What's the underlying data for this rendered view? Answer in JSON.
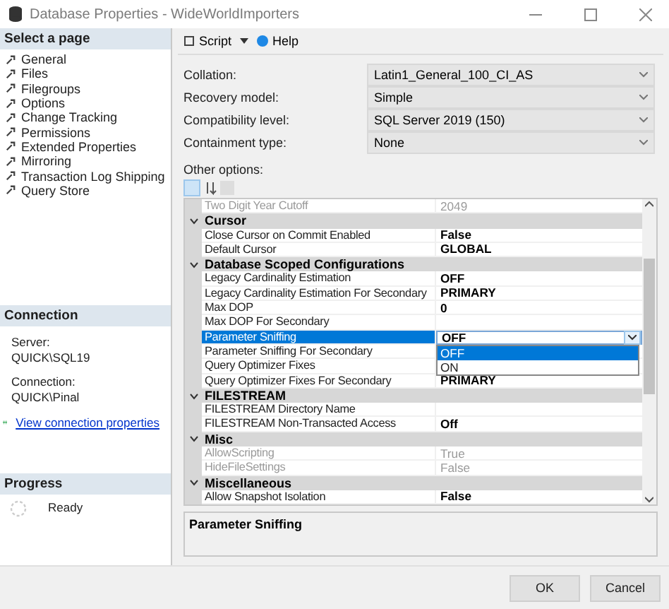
{
  "window": {
    "title": "Database Properties - WideWorldImporters"
  },
  "sidebar": {
    "header": "Select a page",
    "items": [
      {
        "label": "General"
      },
      {
        "label": "Files"
      },
      {
        "label": "Filegroups"
      },
      {
        "label": "Options"
      },
      {
        "label": "Change Tracking"
      },
      {
        "label": "Permissions"
      },
      {
        "label": "Extended Properties"
      },
      {
        "label": "Mirroring"
      },
      {
        "label": "Transaction Log Shipping"
      },
      {
        "label": "Query Store"
      }
    ]
  },
  "connection": {
    "header": "Connection",
    "server_label": "Server:",
    "server": "QUICK\\SQL19",
    "connection_label": "Connection:",
    "connection": "QUICK\\Pinal",
    "link": "View connection properties"
  },
  "progress": {
    "header": "Progress",
    "status": "Ready"
  },
  "toolbar": {
    "script": "Script",
    "help": "Help"
  },
  "fields": [
    {
      "label": "Collation:",
      "value": "Latin1_General_100_CI_AS"
    },
    {
      "label": "Recovery model:",
      "value": "Simple"
    },
    {
      "label": "Compatibility level:",
      "value": "SQL Server 2019 (150)"
    },
    {
      "label": "Containment type:",
      "value": "None"
    }
  ],
  "other_options_label": "Other options:",
  "grid": {
    "rows": [
      {
        "kind": "property",
        "name": "Two Digit Year Cutoff",
        "value": "2049",
        "disabled": true,
        "selected": false
      },
      {
        "kind": "category",
        "name": "Cursor",
        "expanded": true
      },
      {
        "kind": "property",
        "name": "Close Cursor on Commit Enabled",
        "value": "False",
        "disabled": false,
        "selected": false
      },
      {
        "kind": "property",
        "name": "Default Cursor",
        "value": "GLOBAL",
        "disabled": false,
        "selected": false
      },
      {
        "kind": "category",
        "name": "Database Scoped Configurations",
        "expanded": true
      },
      {
        "kind": "property",
        "name": "Legacy Cardinality Estimation",
        "value": "OFF",
        "disabled": false,
        "selected": false
      },
      {
        "kind": "property",
        "name": "Legacy Cardinality Estimation For Secondary",
        "value": "PRIMARY",
        "disabled": false,
        "selected": false
      },
      {
        "kind": "property",
        "name": "Max DOP",
        "value": "0",
        "disabled": false,
        "selected": false
      },
      {
        "kind": "property",
        "name": "Max DOP For Secondary",
        "disabled": false,
        "selected": false
      },
      {
        "kind": "property",
        "name": "Parameter Sniffing",
        "value": "OFF",
        "disabled": false,
        "selected": true,
        "dropdown": [
          {
            "label": "OFF",
            "selected": true
          },
          {
            "label": "ON",
            "selected": false
          }
        ]
      },
      {
        "kind": "property",
        "name": "Parameter Sniffing For Secondary",
        "disabled": false,
        "selected": false
      },
      {
        "kind": "property",
        "name": "Query Optimizer Fixes",
        "disabled": false,
        "selected": false
      },
      {
        "kind": "property",
        "name": "Query Optimizer Fixes For Secondary",
        "value": "PRIMARY",
        "disabled": false,
        "selected": false
      },
      {
        "kind": "category",
        "name": "FILESTREAM",
        "expanded": true
      },
      {
        "kind": "property",
        "name": "FILESTREAM Directory Name",
        "disabled": false,
        "selected": false
      },
      {
        "kind": "property",
        "name": "FILESTREAM Non-Transacted Access",
        "value": "Off",
        "disabled": false,
        "selected": false
      },
      {
        "kind": "category",
        "name": "Misc",
        "expanded": true
      },
      {
        "kind": "property",
        "name": "AllowScripting",
        "value": "True",
        "disabled": true,
        "selected": false
      },
      {
        "kind": "property",
        "name": "HideFileSettings",
        "value": "False",
        "disabled": true,
        "selected": false
      },
      {
        "kind": "category",
        "name": "Miscellaneous",
        "expanded": true
      },
      {
        "kind": "property",
        "name": "Allow Snapshot Isolation",
        "value": "False",
        "disabled": false,
        "selected": false
      }
    ]
  },
  "description": {
    "title": "Parameter Sniffing"
  },
  "buttons": [
    {
      "label": "OK"
    },
    {
      "label": "Cancel"
    }
  ]
}
